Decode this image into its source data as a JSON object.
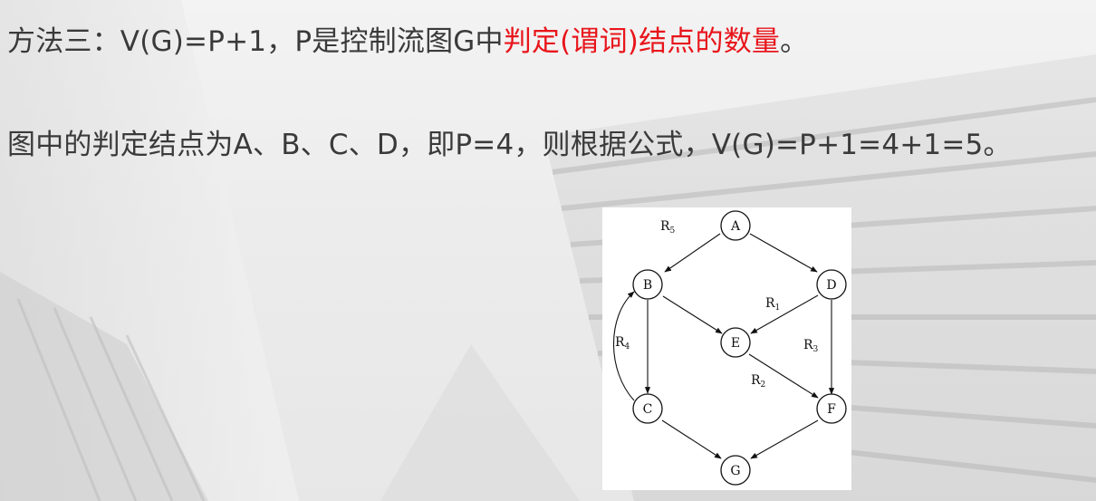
{
  "text": {
    "line1": {
      "prefix": "方法三：V(G)=P+1，P是控制流图G中",
      "highlight": "判定(谓词)结点的数量",
      "suffix": "。"
    },
    "line2": "图中的判定结点为A、B、C、D，即P=4，则根据公式，V(G)=P+1=4+1=5。"
  },
  "colors": {
    "highlight": "#e8151b",
    "body_text": "#3a3a3a"
  },
  "graph": {
    "nodes": [
      "A",
      "B",
      "C",
      "D",
      "E",
      "F",
      "G"
    ],
    "edges": [
      {
        "from": "A",
        "to": "B"
      },
      {
        "from": "A",
        "to": "D"
      },
      {
        "from": "B",
        "to": "C"
      },
      {
        "from": "B",
        "to": "E"
      },
      {
        "from": "D",
        "to": "E"
      },
      {
        "from": "D",
        "to": "F"
      },
      {
        "from": "E",
        "to": "F"
      },
      {
        "from": "C",
        "to": "G"
      },
      {
        "from": "F",
        "to": "G"
      },
      {
        "from": "C",
        "to": "B"
      }
    ],
    "regions": [
      {
        "main": "R",
        "sub": "1"
      },
      {
        "main": "R",
        "sub": "2"
      },
      {
        "main": "R",
        "sub": "3"
      },
      {
        "main": "R",
        "sub": "4"
      },
      {
        "main": "R",
        "sub": "5"
      }
    ]
  }
}
